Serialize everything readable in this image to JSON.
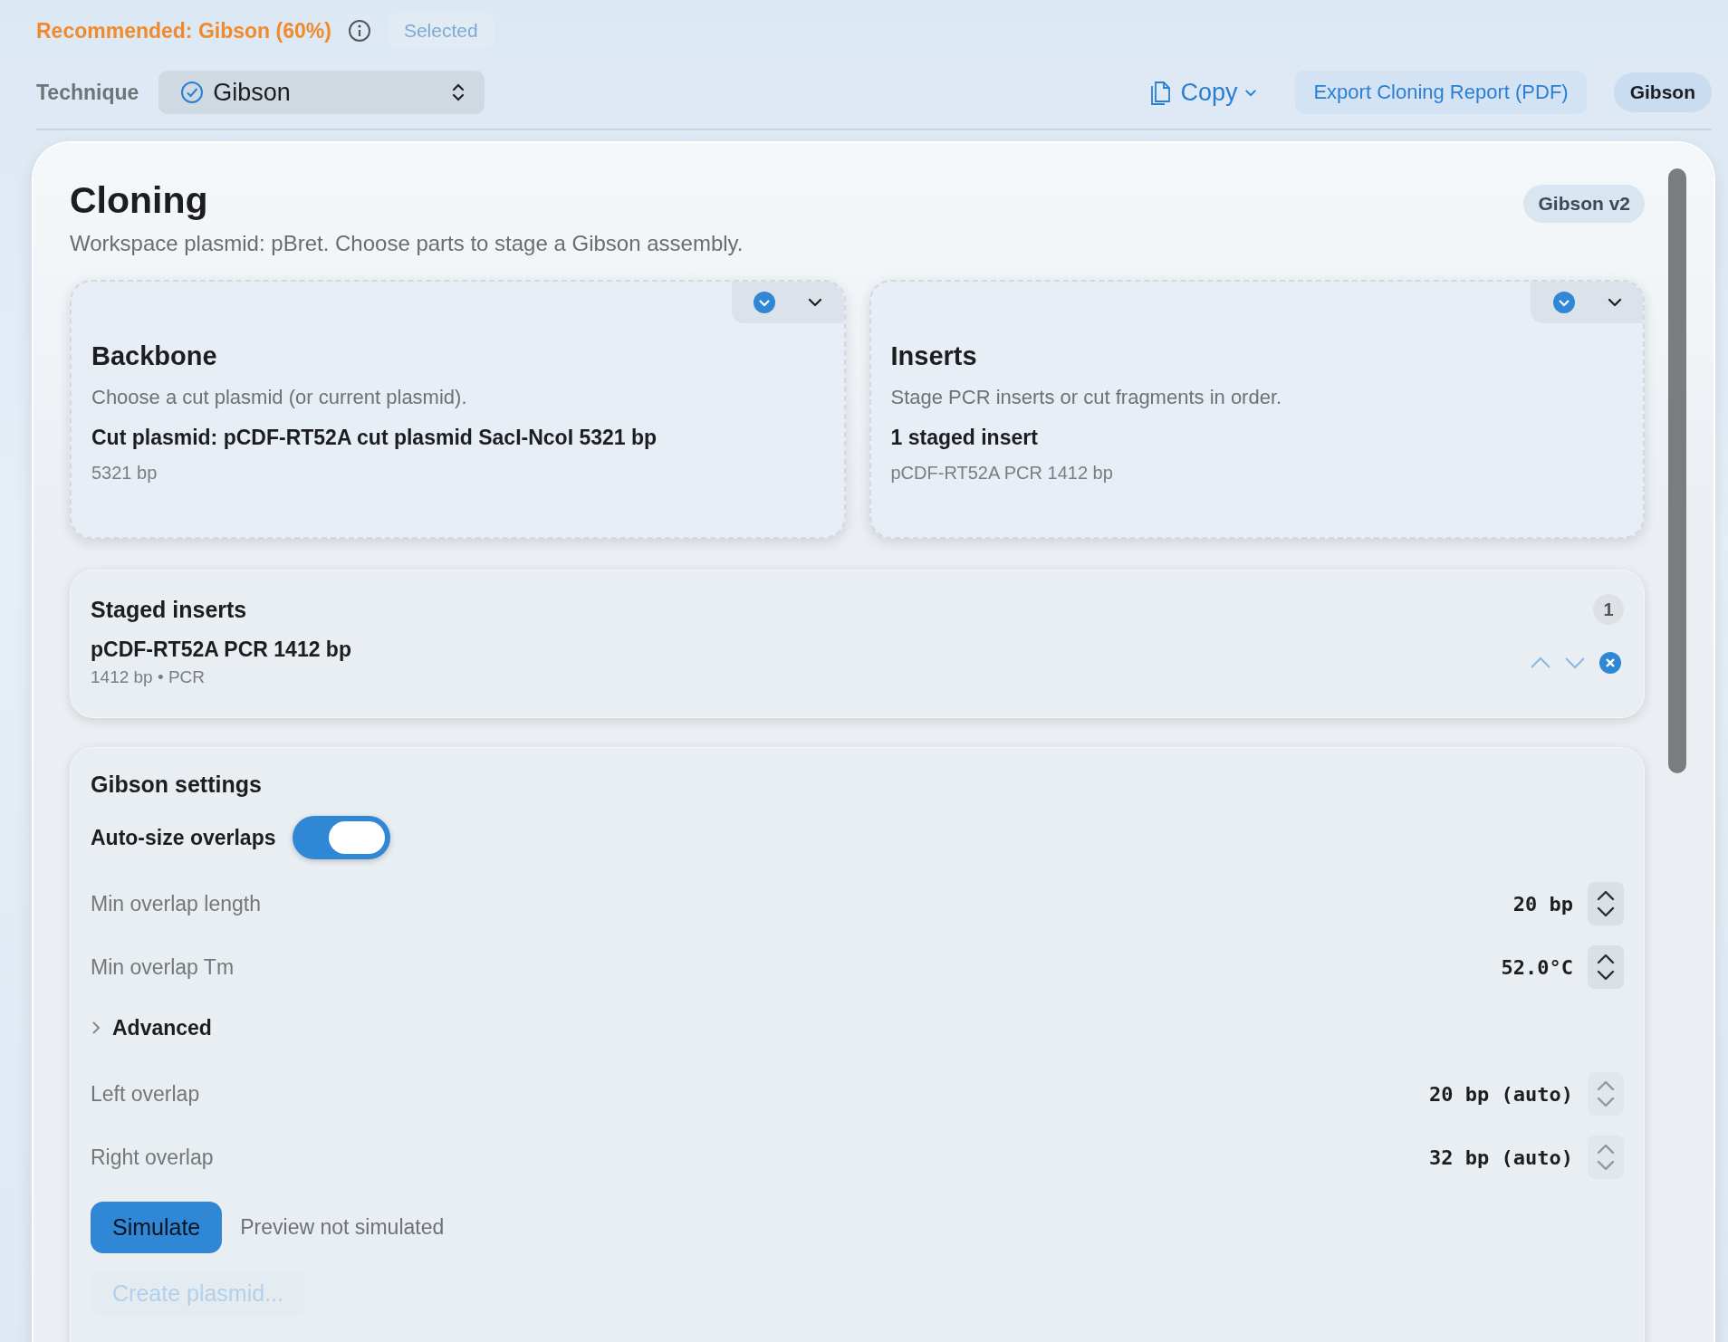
{
  "recommendation": {
    "text": "Recommended: Gibson (60%)",
    "status": {
      "label": "Selected",
      "disabled": true
    }
  },
  "toolbar": {
    "technique_label": "Technique",
    "technique_value": "Gibson",
    "copy_label": "Copy",
    "export_label": "Export Cloning Report (PDF)",
    "badge": "Gibson"
  },
  "panel": {
    "title": "Cloning",
    "version": "Gibson v2",
    "subtitle": "Workspace plasmid: pBret. Choose parts to stage a Gibson assembly.",
    "cards": [
      {
        "title": "Backbone",
        "description": "Choose a cut plasmid (or current plasmid).",
        "summary": "Cut plasmid: pCDF-RT52A cut plasmid SacI-NcoI 5321 bp",
        "detail": "5321 bp"
      },
      {
        "title": "Inserts",
        "description": "Stage PCR inserts or cut fragments in order.",
        "summary": "1 staged insert",
        "detail": "pCDF-RT52A PCR 1412 bp"
      }
    ],
    "staged": {
      "title": "Staged inserts",
      "count": "1",
      "items": [
        {
          "name": "pCDF-RT52A PCR 1412 bp",
          "meta": "1412 bp • PCR"
        }
      ]
    },
    "settings": {
      "title": "Gibson settings",
      "toggle": {
        "label": "Auto-size overlaps",
        "on": true
      },
      "fields": [
        {
          "label": "Min overlap length",
          "value": "20 bp",
          "disabled": false
        },
        {
          "label": "Min overlap Tm",
          "value": "52.0°C",
          "disabled": false
        }
      ],
      "advanced": {
        "label": "Advanced",
        "expanded": false
      },
      "auto_fields": [
        {
          "label": "Left overlap",
          "value": "20 bp (auto)",
          "disabled": true
        },
        {
          "label": "Right overlap",
          "value": "32 bp (auto)",
          "disabled": true
        }
      ],
      "simulate_label": "Simulate",
      "preview_status": "Preview not simulated",
      "create": {
        "label": "Create plasmid...",
        "disabled": true
      }
    }
  }
}
